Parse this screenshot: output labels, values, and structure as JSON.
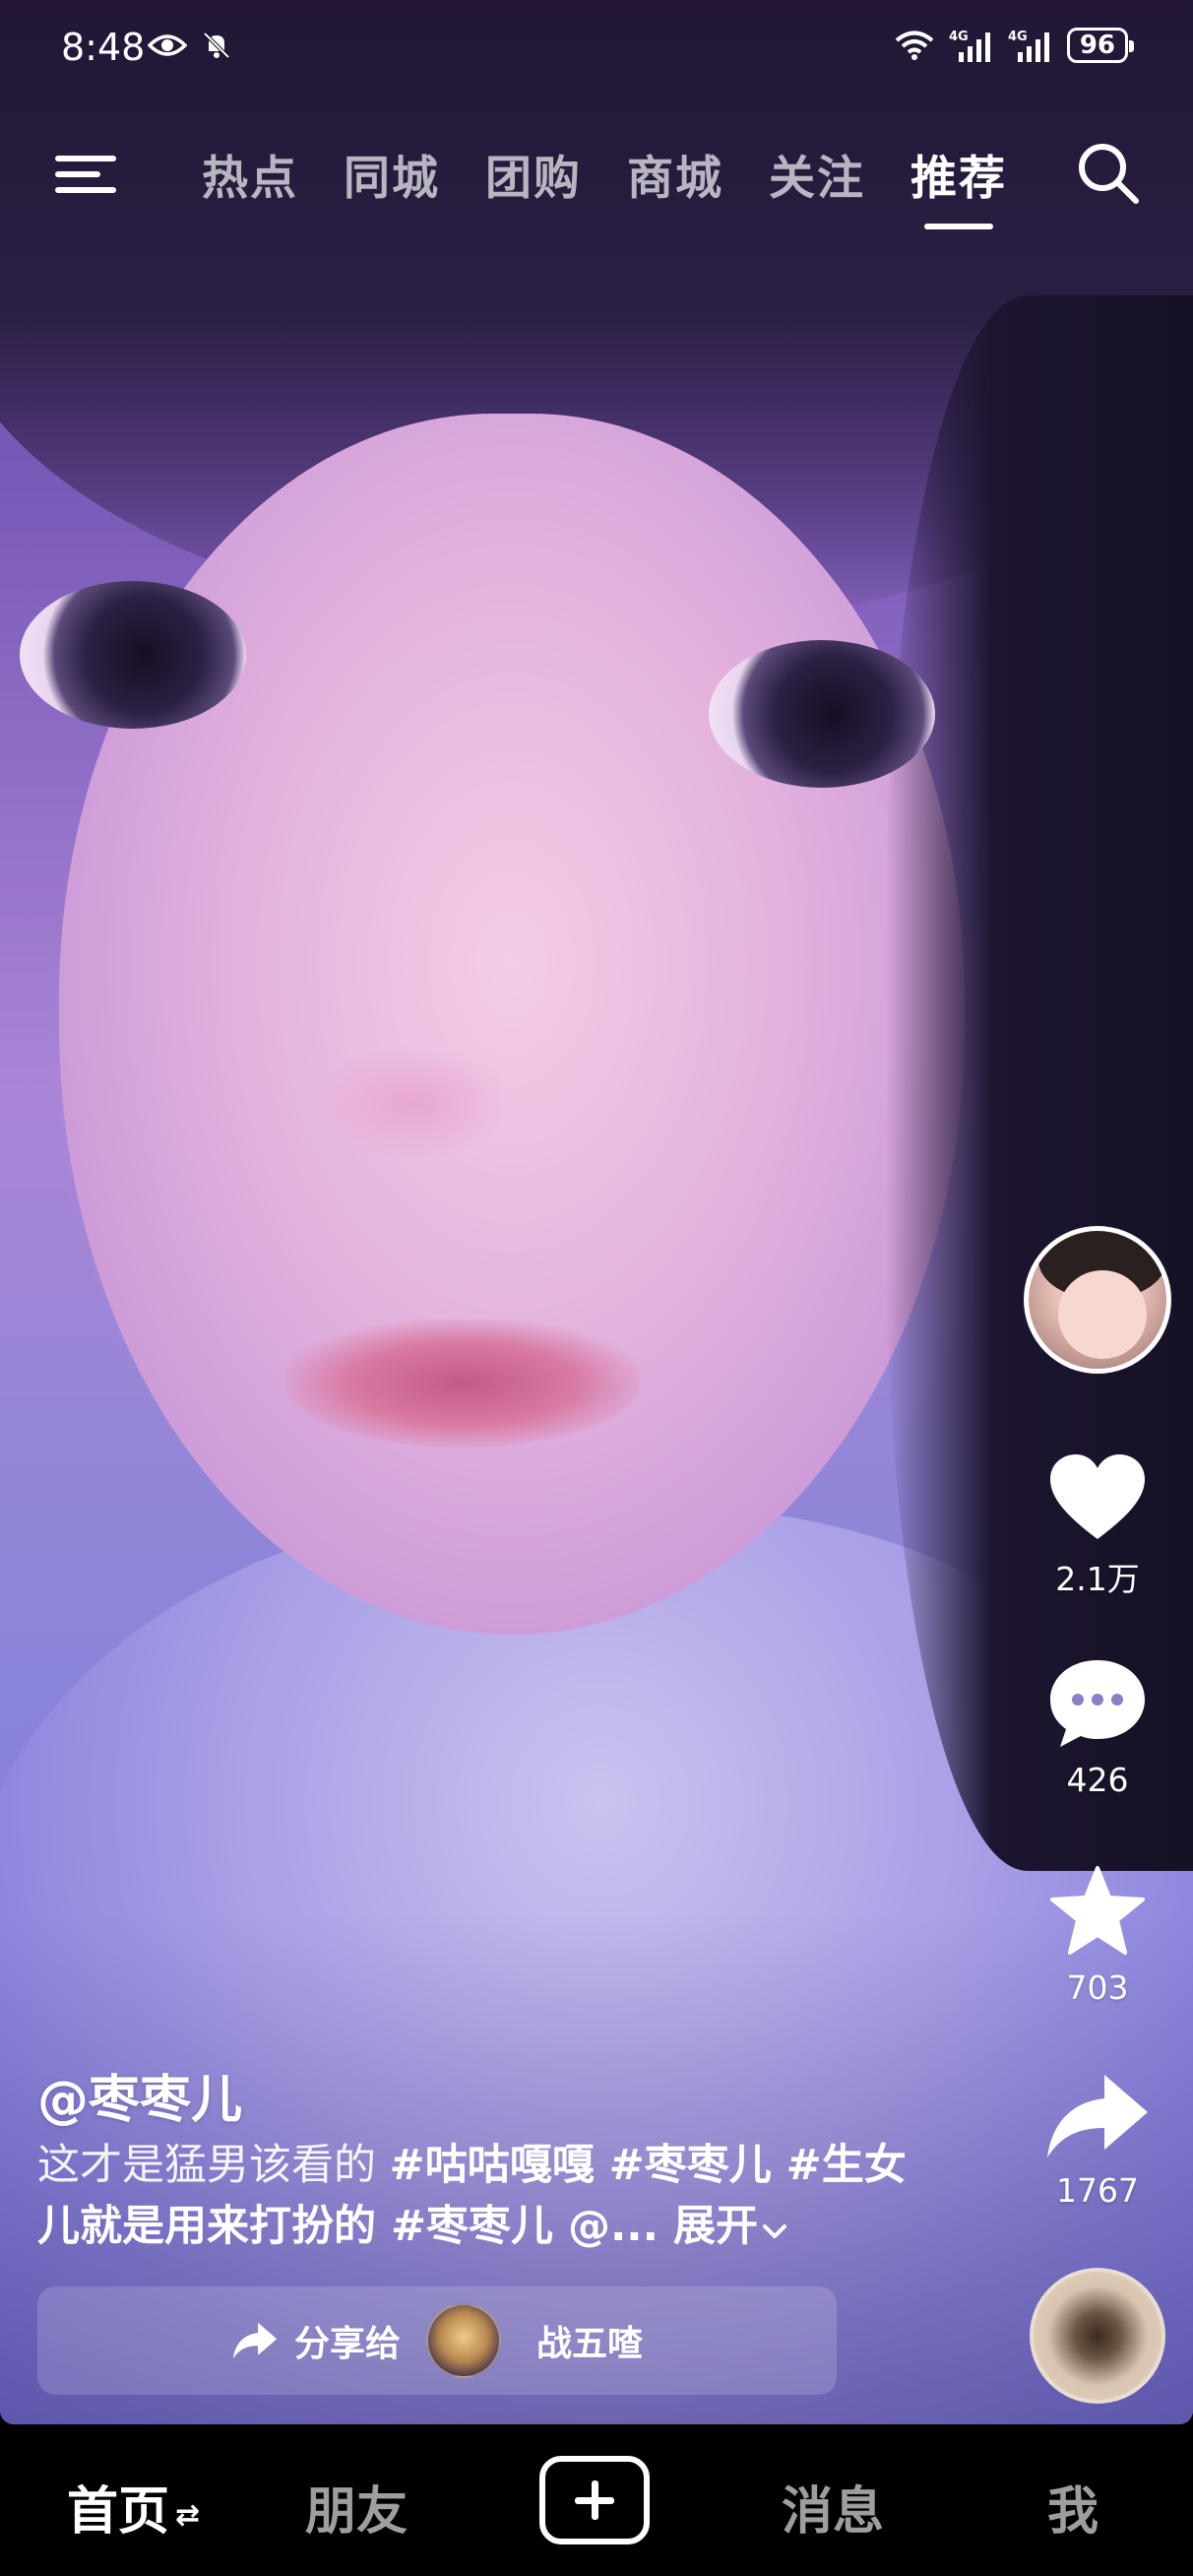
{
  "status_bar": {
    "time": "8:48",
    "battery": "96",
    "icons": [
      "eye-icon",
      "mute-bell-icon",
      "wifi-icon",
      "signal-4g-icon",
      "signal-4g-icon"
    ]
  },
  "top_nav": {
    "tabs": [
      {
        "label": "热点"
      },
      {
        "label": "同城"
      },
      {
        "label": "团购"
      },
      {
        "label": "商城"
      },
      {
        "label": "关注"
      },
      {
        "label": "推荐"
      }
    ],
    "active_tab": "推荐"
  },
  "rail": {
    "likes": "2.1万",
    "comments": "426",
    "favorites": "703",
    "shares": "1767"
  },
  "caption": {
    "author": "@枣枣儿",
    "text_1": "这才是猛男该看的 ",
    "tag_1": "#咕咕嘎嘎",
    "tag_2": " #枣枣儿",
    "tag_3": " #生女儿就是用来打扮的",
    "tag_4": " #枣枣儿",
    "mention": " @...",
    "expand": " 展开"
  },
  "share_bar": {
    "label": "分享给",
    "contact": "战五喳"
  },
  "bottom_bar": {
    "home": "首页",
    "friends": "朋友",
    "messages": "消息",
    "me": "我"
  },
  "colors": {
    "background": "#000000",
    "text": "#ffffff",
    "inactive_text": "rgba(255,255,255,0.62)"
  }
}
